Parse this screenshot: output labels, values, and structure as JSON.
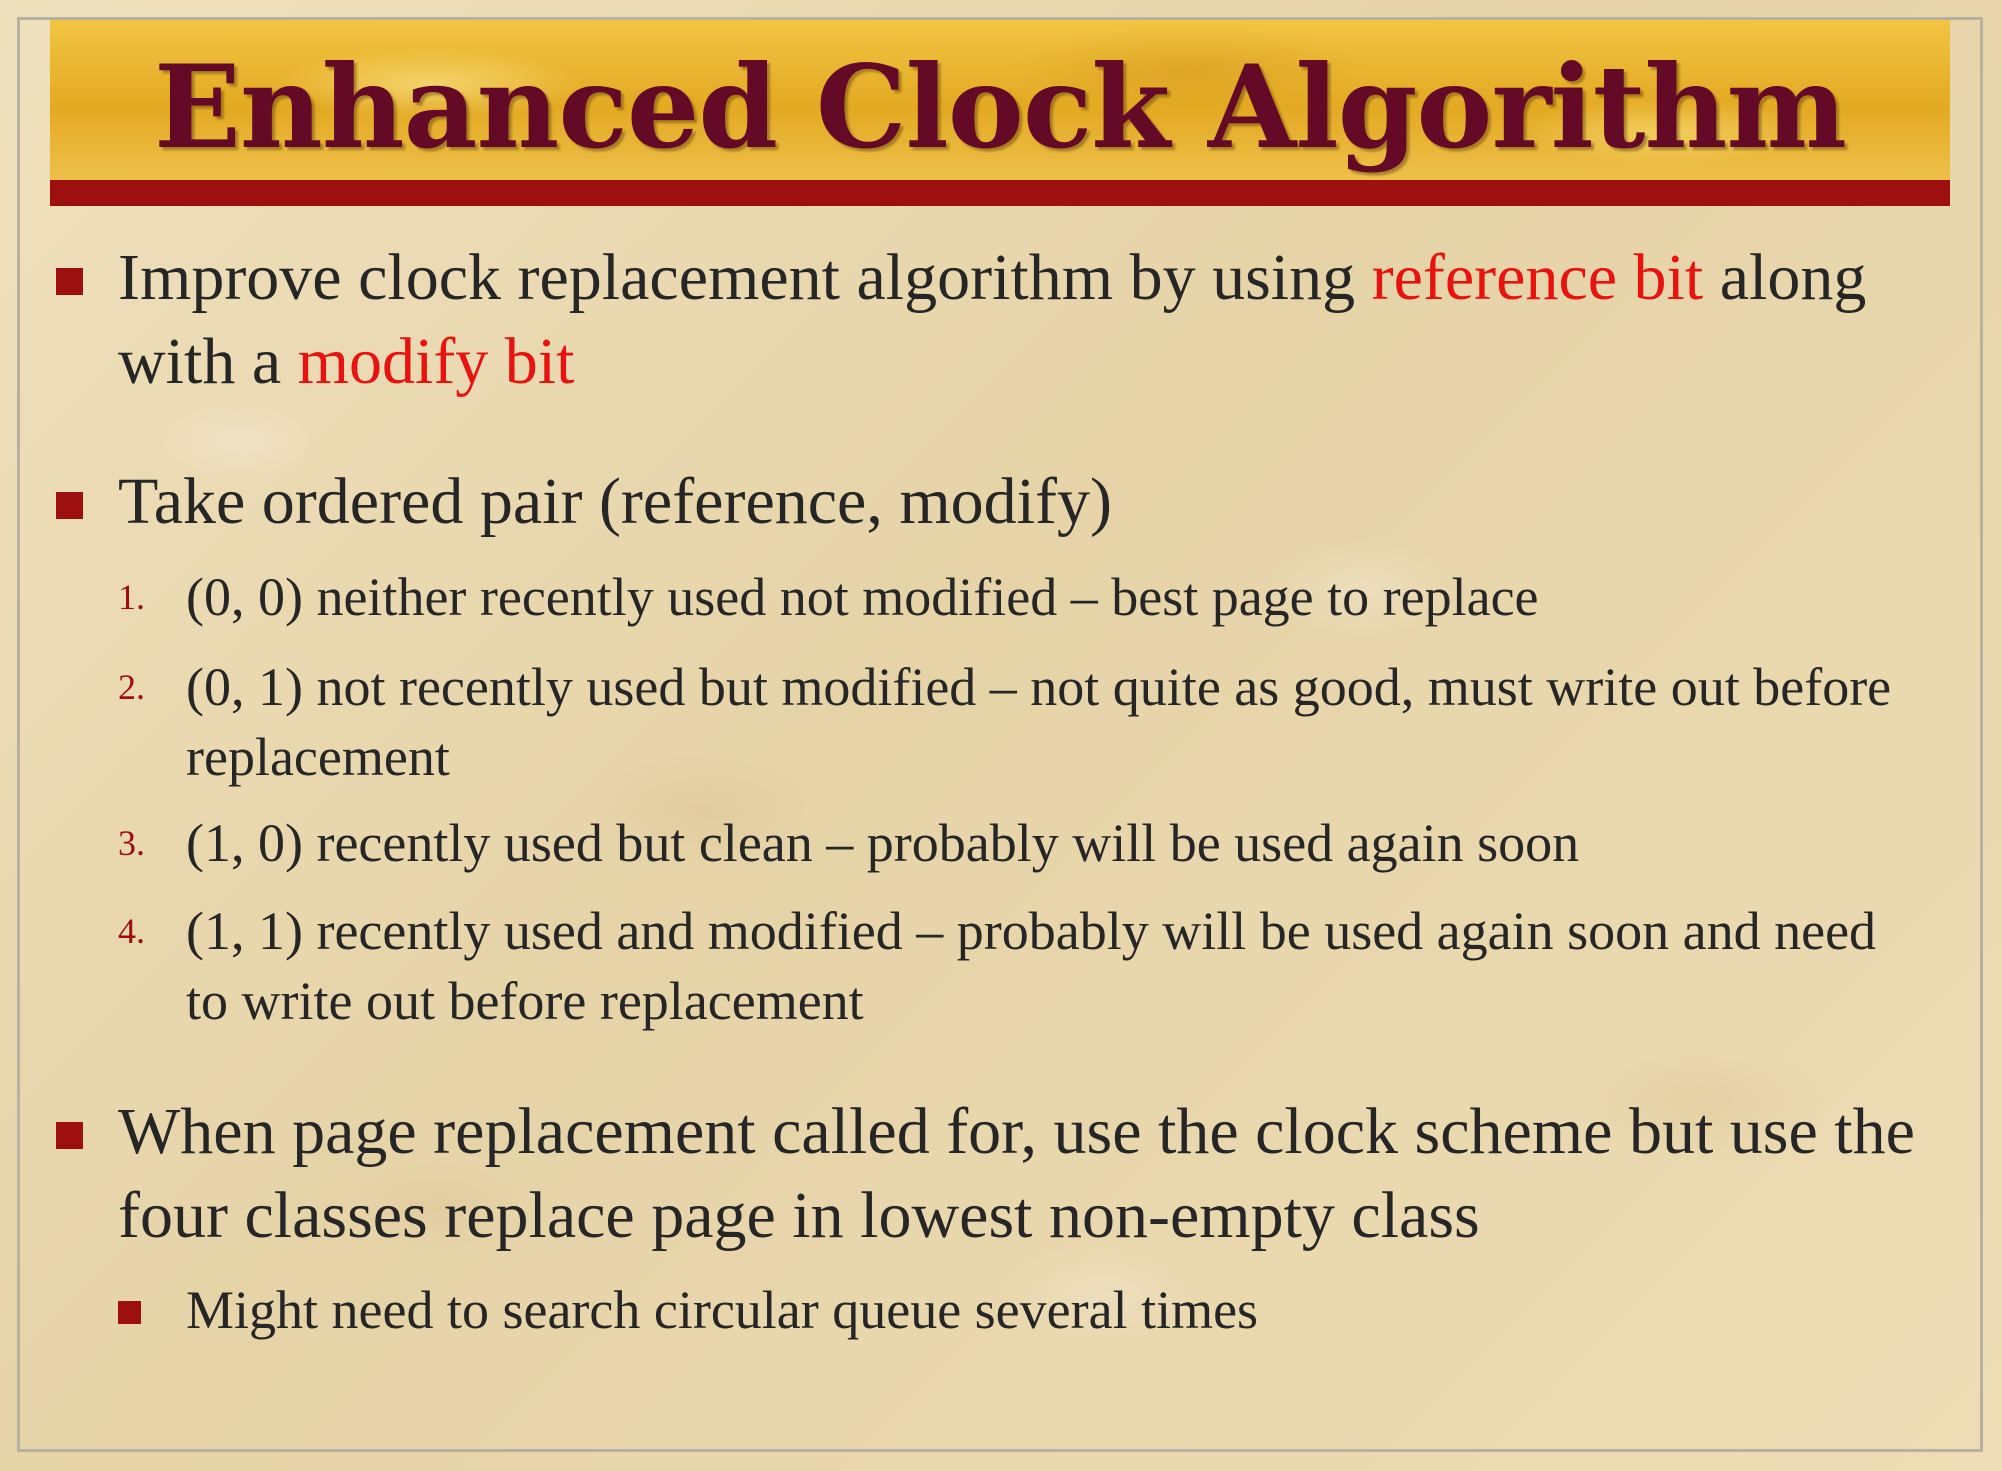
{
  "title": "Enhanced Clock Algorithm",
  "bullets": [
    {
      "text_before": "Improve clock replacement algorithm by using ",
      "highlight_1": "reference bit",
      "text_middle": " along with a ",
      "highlight_2": "modify bit"
    },
    {
      "text": "Take ordered pair (reference, modify)",
      "items": [
        {
          "number": "1.",
          "text": "(0, 0) neither recently used not modified – best page to replace"
        },
        {
          "number": "2.",
          "text": "(0, 1) not recently used but modified – not quite as good, must write out before replacement"
        },
        {
          "number": "3.",
          "text": "(1, 0) recently used but clean – probably will be used again soon"
        },
        {
          "number": "4.",
          "text": "(1, 1) recently used and modified – probably will be used again soon and need to write out before replacement"
        }
      ]
    },
    {
      "text": "When page replacement called for, use the clock scheme  but use the four classes replace page in lowest non-empty class",
      "sub_bullets": [
        {
          "text": "Might need to search circular queue several times"
        }
      ]
    }
  ],
  "colors": {
    "title_text": "#650a26",
    "title_banner": "#e8b42e",
    "title_rule": "#9e0f10",
    "bullet_marker": "#9e0f10",
    "highlight": "#e8120e",
    "body_text": "#262626",
    "background": "#ecdcb6"
  }
}
